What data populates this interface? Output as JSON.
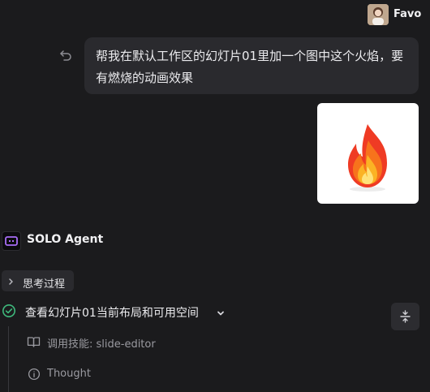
{
  "header": {
    "user_name": "Favo",
    "avatar_icon": "user-avatar"
  },
  "message": {
    "text": "帮我在默认工作区的幻灯片01里加一个图中这个火焰，要有燃烧的动画效果",
    "undo_icon": "undo-icon",
    "attachment_icon": "flame-image"
  },
  "agent": {
    "name": "SOLO Agent",
    "logo_icon": "solo-agent-logo"
  },
  "thinking": {
    "label": "思考过程",
    "icon": "chevron-right-icon"
  },
  "step": {
    "label": "查看幻灯片01当前布局和可用空间",
    "status_icon": "check-circle-icon",
    "expand_icon": "chevron-down-icon",
    "collapse_icon": "collapse-icon",
    "status_color": "#3fb97c",
    "substeps": [
      {
        "label": "调用技能: slide-editor",
        "icon": "book-icon"
      },
      {
        "label": "Thought",
        "icon": "info-icon"
      }
    ]
  }
}
